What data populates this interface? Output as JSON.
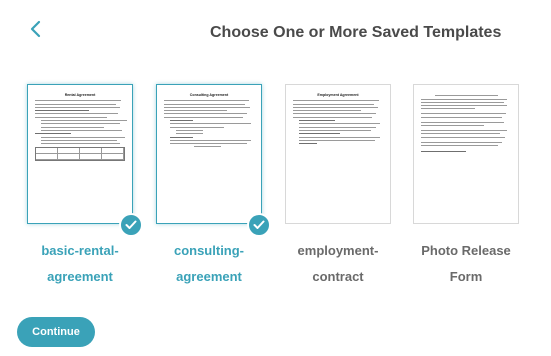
{
  "header": {
    "back_icon": "chevron-left-icon",
    "title": "Choose One or More Saved Templates"
  },
  "templates": [
    {
      "name": "basic-rental-agreement",
      "label_line1": "basic-rental-",
      "label_line2": "agreement",
      "doc_title": "Rental Agreement",
      "selected": true
    },
    {
      "name": "consulting-agreement",
      "label_line1": "consulting-",
      "label_line2": "agreement",
      "doc_title": "Consulting Agreement",
      "selected": true
    },
    {
      "name": "employment-contract",
      "label_line1": "employment-",
      "label_line2": "contract",
      "doc_title": "Employment Agreement",
      "selected": false
    },
    {
      "name": "photo-release-form",
      "label_line1": "Photo Release",
      "label_line2": "Form",
      "doc_title": "",
      "selected": false
    }
  ],
  "footer": {
    "continue_label": "Continue"
  },
  "colors": {
    "accent": "#3aa2b8",
    "title": "#4a4a4a",
    "muted_label": "#6a6a6a"
  }
}
